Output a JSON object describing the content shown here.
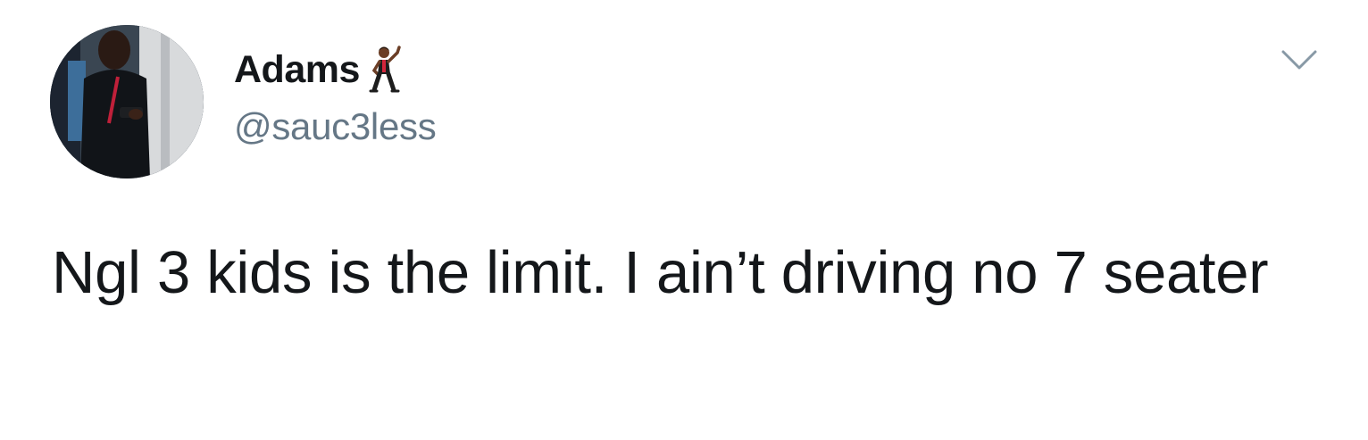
{
  "tweet": {
    "author": {
      "display_name": "Adams",
      "handle": "@sauc3less",
      "name_emoji": "dancing-man-emoji",
      "avatar": "profile-photo"
    },
    "menu_icon": "chevron-down-icon",
    "text": "Ngl 3 kids is the limit. I ain’t driving no 7 seater"
  },
  "colors": {
    "text_primary": "#14171a",
    "text_secondary": "#657786",
    "background": "#ffffff"
  }
}
